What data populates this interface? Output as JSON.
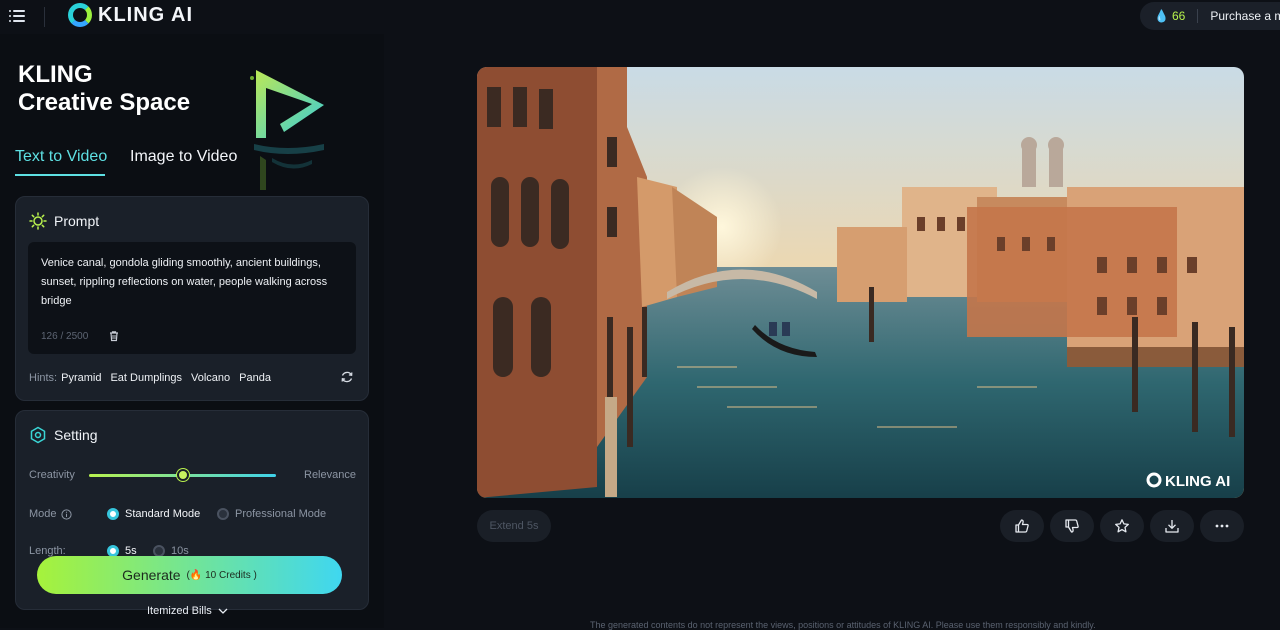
{
  "topbar": {
    "app_name": "KLING AI",
    "credits": "66",
    "purchase_label": "Purchase a mer"
  },
  "hero": {
    "title_line1": "KLING",
    "title_line2": "Creative Space"
  },
  "tabs": [
    {
      "label": "Text to Video",
      "active": true
    },
    {
      "label": "Image to Video",
      "active": false
    }
  ],
  "prompt": {
    "heading": "Prompt",
    "text": "Venice canal, gondola gliding smoothly, ancient buildings, sunset, rippling reflections on water, people walking across bridge",
    "counter": "126 / 2500",
    "hints_label": "Hints:",
    "hints": [
      "Pyramid",
      "Eat Dumplings",
      "Volcano",
      "Panda"
    ]
  },
  "setting": {
    "heading": "Setting",
    "creativity_label": "Creativity",
    "relevance_label": "Relevance",
    "creativity_value": 0.5,
    "mode_label": "Mode",
    "modes": [
      {
        "label": "Standard Mode",
        "selected": true
      },
      {
        "label": "Professional Mode",
        "selected": false
      }
    ],
    "length_label": "Length:",
    "lengths": [
      {
        "label": "5s",
        "selected": true
      },
      {
        "label": "10s",
        "selected": false
      }
    ]
  },
  "generate": {
    "label": "Generate",
    "credits": "10 Credits"
  },
  "itemized_label": "Itemized Bills",
  "preview": {
    "watermark": "KLING AI",
    "extend_label": "Extend 5s",
    "actions": [
      "thumbs-up-icon",
      "thumbs-down-icon",
      "star-icon",
      "download-icon",
      "more-icon"
    ]
  },
  "disclaimer": "The generated contents do not represent the views, positions or attitudes of KLING AI. Please use them responsibly and kindly.",
  "colors": {
    "accent": "#5ee0e3",
    "generate_start": "#a6f23b",
    "generate_end": "#3fd7f0"
  }
}
